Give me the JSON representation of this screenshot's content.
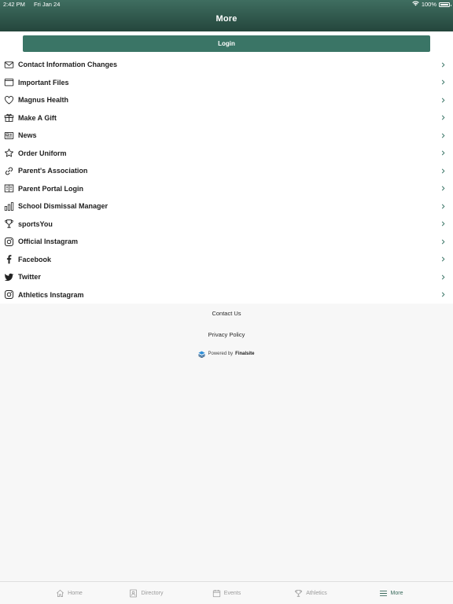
{
  "status_bar": {
    "time": "2:42 PM",
    "date": "Fri Jan 24",
    "battery": "100%",
    "icons": [
      "wifi-icon",
      "battery-icon"
    ]
  },
  "header": {
    "title": "More"
  },
  "login": {
    "label": "Login"
  },
  "menu": {
    "items": [
      {
        "label": "Contact Information Changes",
        "icon": "envelope-icon"
      },
      {
        "label": "Important Files",
        "icon": "folder-icon"
      },
      {
        "label": "Magnus Health",
        "icon": "heart-icon"
      },
      {
        "label": "Make A Gift",
        "icon": "gift-icon"
      },
      {
        "label": "News",
        "icon": "newspaper-icon"
      },
      {
        "label": "Order Uniform",
        "icon": "star-icon"
      },
      {
        "label": "Parent's Association",
        "icon": "link-icon"
      },
      {
        "label": "Parent Portal Login",
        "icon": "book-icon"
      },
      {
        "label": "School Dismissal Manager",
        "icon": "bar-chart-icon"
      },
      {
        "label": "sportsYou",
        "icon": "trophy-icon"
      },
      {
        "label": "Official Instagram",
        "icon": "instagram-icon"
      },
      {
        "label": "Facebook",
        "icon": "facebook-icon"
      },
      {
        "label": "Twitter",
        "icon": "twitter-icon"
      },
      {
        "label": "Athletics Instagram",
        "icon": "instagram-icon"
      }
    ]
  },
  "footer": {
    "contact": "Contact Us",
    "privacy": "Privacy Policy",
    "powered_prefix": "Powered by",
    "powered_brand": "Finalsite"
  },
  "tabs": [
    {
      "label": "Home",
      "icon": "home-icon",
      "active": false
    },
    {
      "label": "Directory",
      "icon": "directory-icon",
      "active": false
    },
    {
      "label": "Events",
      "icon": "calendar-icon",
      "active": false
    },
    {
      "label": "Athletics",
      "icon": "trophy-icon",
      "active": false
    },
    {
      "label": "More",
      "icon": "menu-icon",
      "active": true
    }
  ],
  "colors": {
    "header_top": "#3f6e60",
    "header_bottom": "#24463c",
    "accent": "#3a7566",
    "active_tab": "#3a6a5c",
    "chevron": "#3a7566"
  }
}
